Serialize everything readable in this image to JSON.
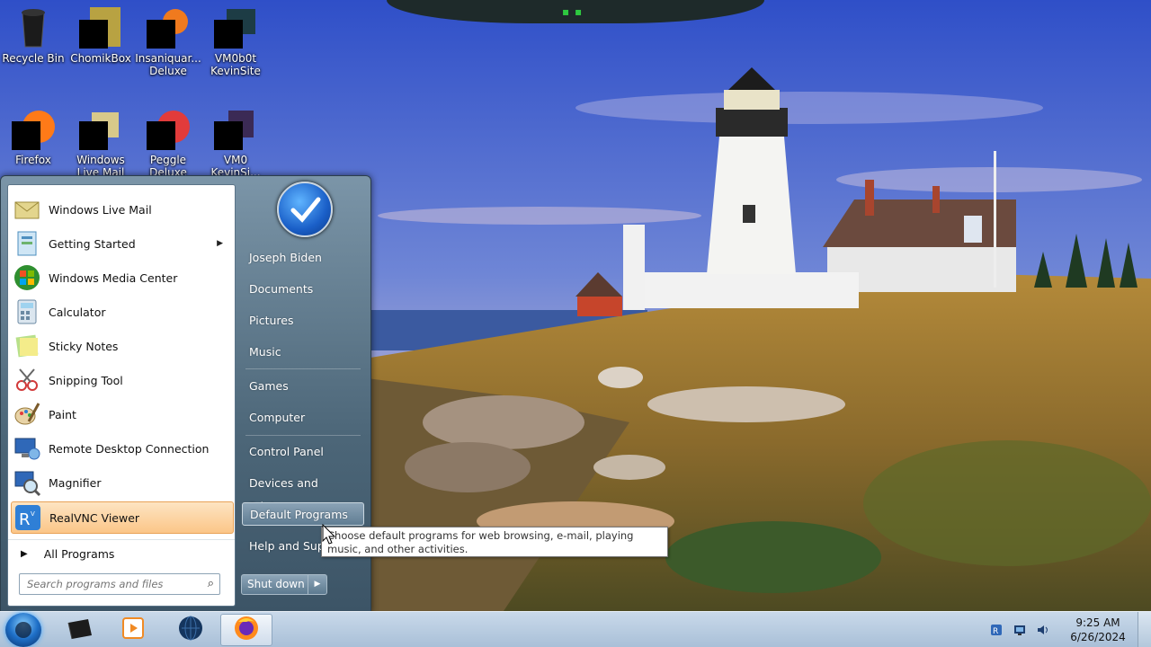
{
  "desktop": {
    "icons": [
      {
        "label": "Recycle Bin"
      },
      {
        "label": "ChomikBox"
      },
      {
        "label": "Insaniquar... Deluxe"
      },
      {
        "label": "VM0b0t KevinSite"
      },
      {
        "label": "Firefox"
      },
      {
        "label": "Windows Live Mail"
      },
      {
        "label": "Peggle Deluxe"
      },
      {
        "label": "VM0 KevinSi..."
      }
    ]
  },
  "start_menu": {
    "programs": [
      {
        "label": "Windows Live Mail",
        "icon": "mail-icon"
      },
      {
        "label": "Getting Started",
        "icon": "getting-started-icon",
        "has_submenu": true
      },
      {
        "label": "Windows Media Center",
        "icon": "media-center-icon"
      },
      {
        "label": "Calculator",
        "icon": "calculator-icon"
      },
      {
        "label": "Sticky Notes",
        "icon": "sticky-notes-icon"
      },
      {
        "label": "Snipping Tool",
        "icon": "scissors-icon"
      },
      {
        "label": "Paint",
        "icon": "paint-icon"
      },
      {
        "label": "Remote Desktop Connection",
        "icon": "remote-desktop-icon"
      },
      {
        "label": "Magnifier",
        "icon": "magnifier-icon"
      },
      {
        "label": "RealVNC Viewer",
        "icon": "vnc-icon",
        "highlighted": true
      }
    ],
    "all_programs_label": "All Programs",
    "search_placeholder": "Search programs and files",
    "right_items": [
      {
        "label": "Joseph Biden"
      },
      {
        "label": "Documents"
      },
      {
        "label": "Pictures"
      },
      {
        "label": "Music"
      },
      {
        "label": "Games"
      },
      {
        "label": "Computer"
      },
      {
        "label": "Control Panel"
      },
      {
        "label": "Devices and Printers"
      },
      {
        "label": "Default Programs",
        "highlighted": true
      },
      {
        "label": "Help and Supp"
      }
    ],
    "shutdown_label": "Shut down"
  },
  "tooltip": {
    "text": "Choose default programs for web browsing, e-mail, playing music, and other activities."
  },
  "taskbar": {
    "clock_time": "9:25 AM",
    "clock_date": "6/26/2024"
  },
  "colors": {
    "accent_highlight": "#fbc688",
    "taskbar": "#b9cde2",
    "menu_right": "#4c6678"
  }
}
